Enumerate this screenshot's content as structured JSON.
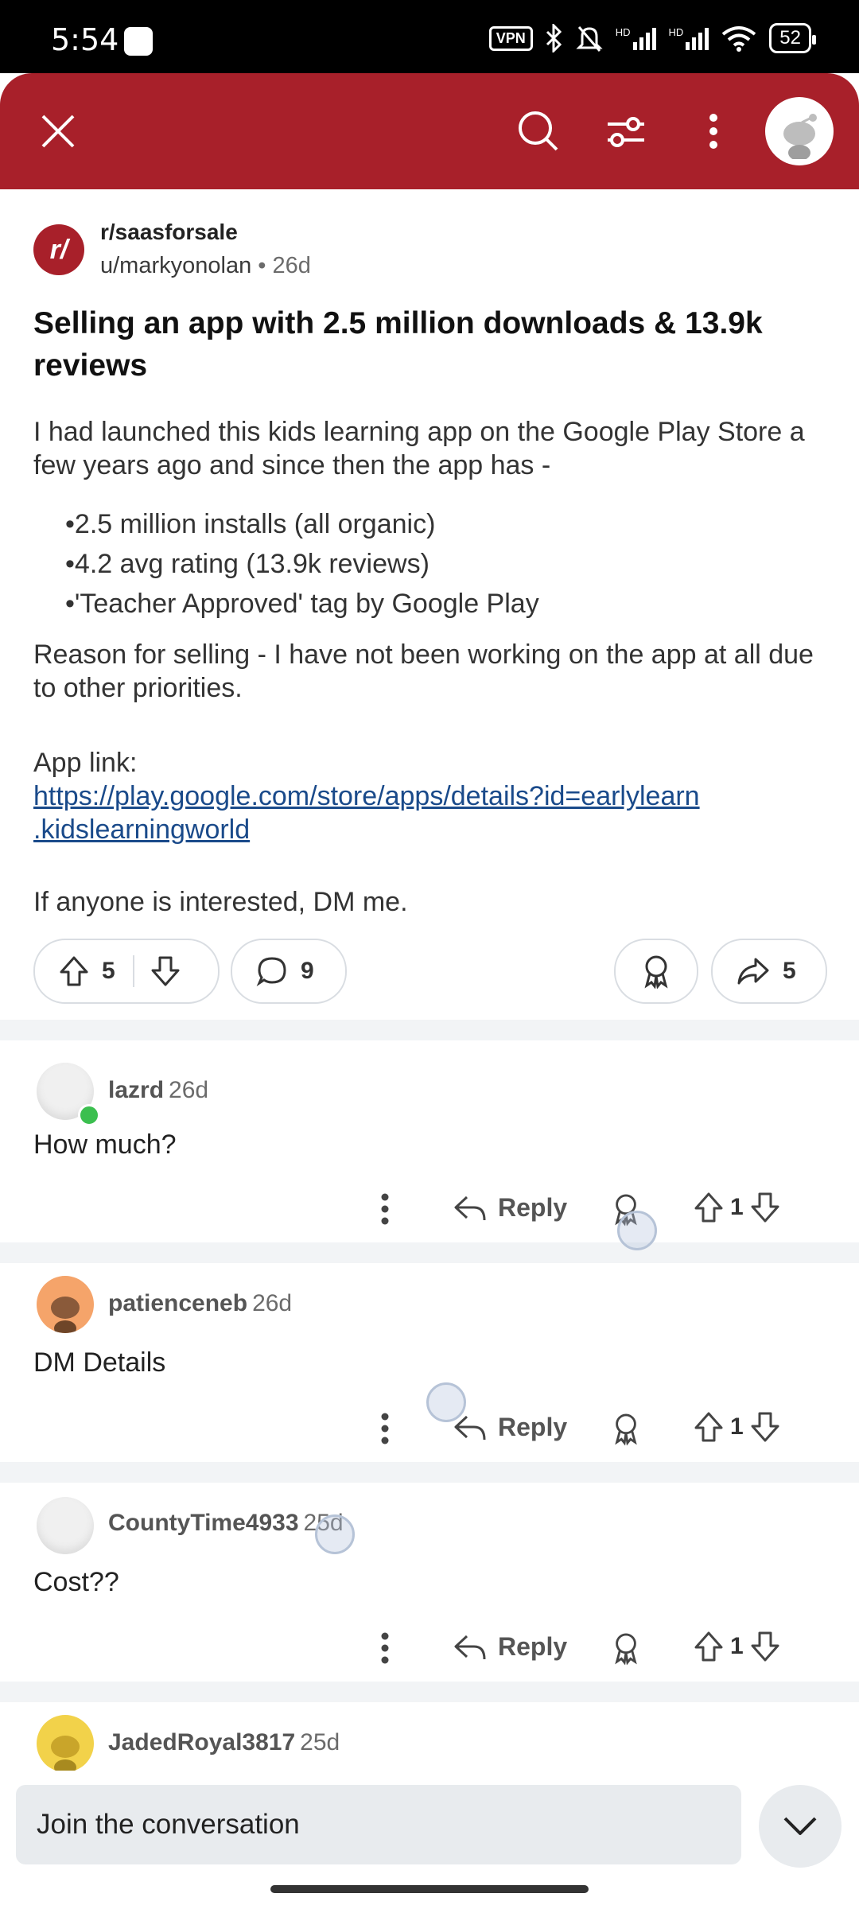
{
  "status_bar": {
    "time": "5:54",
    "vpn": "VPN",
    "network_1": "HD",
    "network_2": "HD",
    "battery": "52"
  },
  "toolbar": {
    "close_icon": "close-icon",
    "search_icon": "search-icon",
    "filter_icon": "filter-icon",
    "more_icon": "more-vertical-icon",
    "profile_icon": "snoo-avatar"
  },
  "post": {
    "subreddit": "r/saasforsale",
    "subreddit_logo": "r/",
    "username": "u/markyonolan",
    "separator": "•",
    "age": "26d",
    "title": "Selling an app with 2.5 million downloads & 13.9k reviews",
    "intro": "I had launched this kids learning app on the Google Play Store a few years ago and since then the app has -",
    "bullets": [
      "2.5 million installs (all organic)",
      "4.2 avg rating (13.9k reviews)",
      "'Teacher Approved' tag by Google Play"
    ],
    "reason": "Reason for selling - I have not been working on the app at all due to other priorities.",
    "link_label": "App link:",
    "link_line1": "https://play.google.com/store/apps/details?id=earlylearn",
    "link_line2": ".kidslearningworld",
    "closing": "If anyone is interested, DM me.",
    "upvotes": "5",
    "comments": "9",
    "shares": "5"
  },
  "comments": [
    {
      "user": "lazrd",
      "age": "26d",
      "text": "How much?",
      "reply_label": "Reply",
      "votes": "1"
    },
    {
      "user": "patienceneb",
      "age": "26d",
      "text": "DM Details",
      "reply_label": "Reply",
      "votes": "1"
    },
    {
      "user": "CountyTime4933",
      "age": "25d",
      "text": "Cost??",
      "reply_label": "Reply",
      "votes": "1"
    },
    {
      "user": "JadedRoyal3817",
      "age": "25d"
    }
  ],
  "composer": {
    "placeholder": "Join the conversation"
  },
  "colors": {
    "brand": "#a8202a",
    "link": "#1a4a8a",
    "divider": "#f2f4f6"
  }
}
